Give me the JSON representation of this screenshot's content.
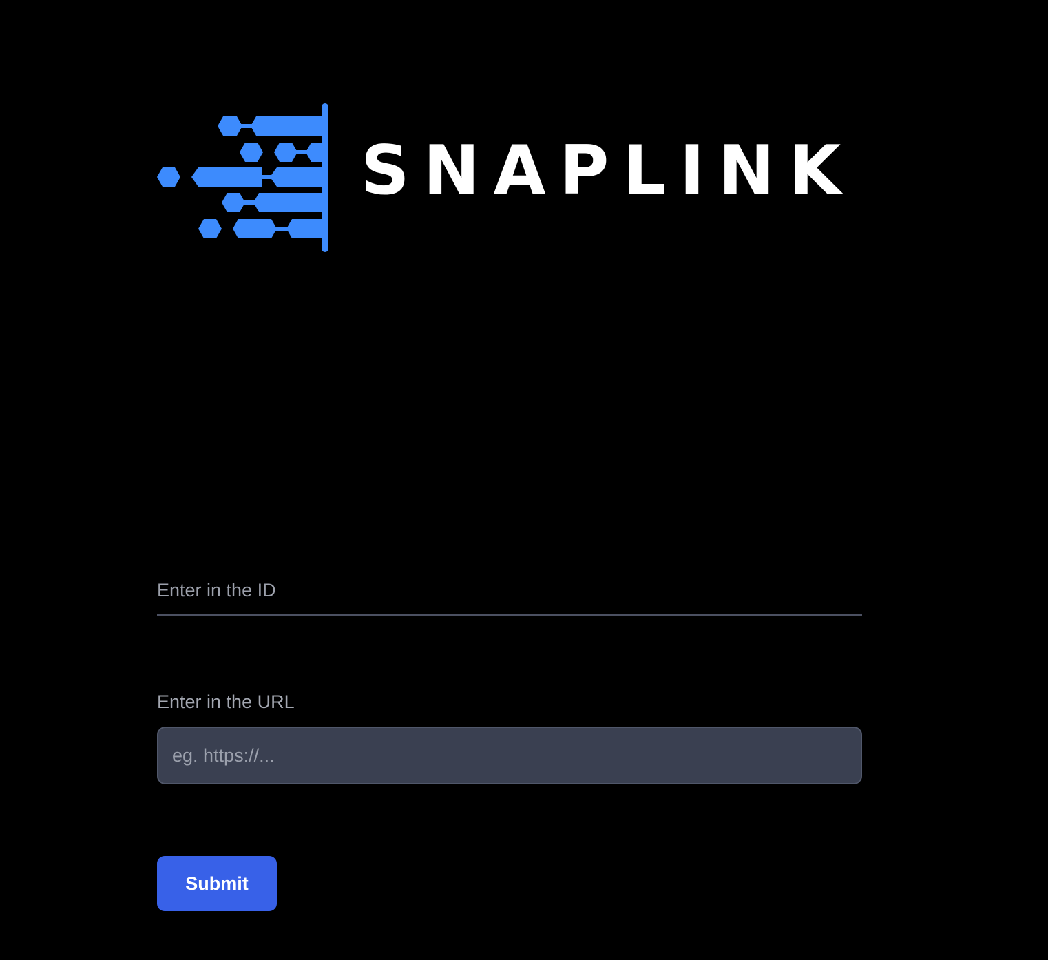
{
  "brand": {
    "name": "SNAPLINK",
    "logo_icon": "hexagon-circuit-icon",
    "accent": "#3d8bfd"
  },
  "form": {
    "id_field": {
      "placeholder": "Enter in the ID",
      "value": ""
    },
    "url_field": {
      "label": "Enter in the URL",
      "placeholder": "eg. https://...",
      "value": ""
    },
    "submit_label": "Submit"
  },
  "colors": {
    "background": "#000000",
    "button": "#3861e8",
    "input_fill": "#3a4051"
  }
}
